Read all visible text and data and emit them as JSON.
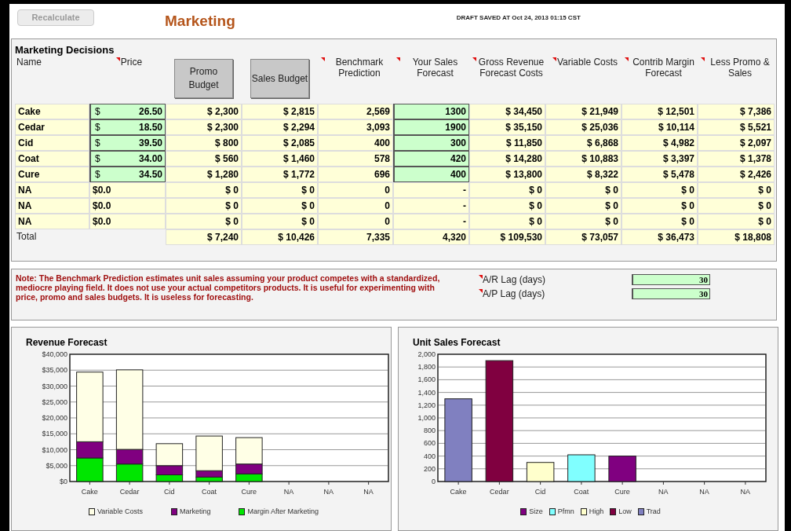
{
  "toolbar": {
    "recalculate_button": {
      "label": "Recalculate",
      "disabled": true
    },
    "title": "Marketing",
    "draft_status": "DRAFT SAVED AT Oct 24, 2013 01:15 CST"
  },
  "decisions": {
    "title": "Marketing Decisions",
    "columns": [
      {
        "label": "Name",
        "kind": "text",
        "comment": false
      },
      {
        "label": "Price",
        "kind": "text",
        "comment": true
      },
      {
        "label": "Promo Budget",
        "kind": "button",
        "comment": false
      },
      {
        "label": "Sales Budget",
        "kind": "button",
        "comment": false
      },
      {
        "label": "Benchmark Prediction",
        "kind": "text",
        "comment": true
      },
      {
        "label": "Your Sales Forecast",
        "kind": "text",
        "comment": true
      },
      {
        "label": "Gross Revenue Forecast Costs",
        "kind": "text",
        "comment": true
      },
      {
        "label": "Variable Costs",
        "kind": "text",
        "comment": true
      },
      {
        "label": "Contrib Margin Forecast",
        "kind": "text",
        "comment": true
      },
      {
        "label": "Less Promo & Sales",
        "kind": "text",
        "comment": true
      }
    ],
    "rows": [
      {
        "kind": "product",
        "name": "Cake",
        "currency": "$",
        "price": "26.50",
        "promo": "$ 2,300",
        "sales": "$ 2,815",
        "benchmark": "2,569",
        "forecast": "1300",
        "gross": "$ 34,450",
        "variable": "$ 21,949",
        "contrib": "$ 12,501",
        "less": "$ 7,386"
      },
      {
        "kind": "product",
        "name": "Cedar",
        "currency": "$",
        "price": "18.50",
        "promo": "$ 2,300",
        "sales": "$ 2,294",
        "benchmark": "3,093",
        "forecast": "1900",
        "gross": "$ 35,150",
        "variable": "$ 25,036",
        "contrib": "$ 10,114",
        "less": "$ 5,521"
      },
      {
        "kind": "product",
        "name": "Cid",
        "currency": "$",
        "price": "39.50",
        "promo": "$ 800",
        "sales": "$ 2,085",
        "benchmark": "400",
        "forecast": "300",
        "gross": "$ 11,850",
        "variable": "$ 6,868",
        "contrib": "$ 4,982",
        "less": "$ 2,097"
      },
      {
        "kind": "product",
        "name": "Coat",
        "currency": "$",
        "price": "34.00",
        "promo": "$ 560",
        "sales": "$ 1,460",
        "benchmark": "578",
        "forecast": "420",
        "gross": "$ 14,280",
        "variable": "$ 10,883",
        "contrib": "$ 3,397",
        "less": "$ 1,378"
      },
      {
        "kind": "product",
        "name": "Cure",
        "currency": "$",
        "price": "34.50",
        "promo": "$ 1,280",
        "sales": "$ 1,772",
        "benchmark": "696",
        "forecast": "400",
        "gross": "$ 13,800",
        "variable": "$ 8,322",
        "contrib": "$ 5,478",
        "less": "$ 2,426"
      },
      {
        "kind": "empty",
        "name": "NA",
        "price": "$0.0",
        "promo": "$ 0",
        "sales": "$ 0",
        "benchmark": "0",
        "forecast": "-",
        "gross": "$ 0",
        "variable": "$ 0",
        "contrib": "$ 0",
        "less": "$ 0"
      },
      {
        "kind": "empty",
        "name": "NA",
        "price": "$0.0",
        "promo": "$ 0",
        "sales": "$ 0",
        "benchmark": "0",
        "forecast": "-",
        "gross": "$ 0",
        "variable": "$ 0",
        "contrib": "$ 0",
        "less": "$ 0"
      },
      {
        "kind": "empty",
        "name": "NA",
        "price": "$0.0",
        "promo": "$ 0",
        "sales": "$ 0",
        "benchmark": "0",
        "forecast": "-",
        "gross": "$ 0",
        "variable": "$ 0",
        "contrib": "$ 0",
        "less": "$ 0"
      }
    ],
    "total": {
      "label": "Total",
      "promo": "$ 7,240",
      "sales": "$ 10,426",
      "benchmark": "7,335",
      "forecast": "4,320",
      "gross": "$ 109,530",
      "variable": "$ 73,057",
      "contrib": "$ 36,473",
      "less": "$ 18,808"
    }
  },
  "settings": {
    "note": "Note: The Benchmark Prediction estimates unit sales assuming your product competes with a standardized, mediocre playing field. It does not use your actual competitors products. It is useful for experimenting with price, promo and sales budgets. It is useless for forecasting.",
    "fields": [
      {
        "label": "A/R Lag (days)",
        "value": "30"
      },
      {
        "label": "A/P Lag (days)",
        "value": "30"
      }
    ]
  },
  "revenue_chart": {
    "chart_data": {
      "type": "bar",
      "title": "Revenue Forecast",
      "stacked": true,
      "categories": [
        "Cake",
        "Cedar",
        "Cid",
        "Coat",
        "Cure",
        "NA",
        "NA",
        "NA"
      ],
      "ylim": [
        0,
        40000
      ],
      "yticks": [
        {
          "value": 0,
          "label": "$0"
        },
        {
          "value": 5000,
          "label": "$5,000"
        },
        {
          "value": 10000,
          "label": "$10,000"
        },
        {
          "value": 15000,
          "label": "$15,000"
        },
        {
          "value": 20000,
          "label": "$20,000"
        },
        {
          "value": 25000,
          "label": "$25,000"
        },
        {
          "value": 30000,
          "label": "$30,000"
        },
        {
          "value": 35000,
          "label": "$35,000"
        },
        {
          "value": 40000,
          "label": "$40,000"
        }
      ],
      "series": [
        {
          "name": "Variable Costs",
          "color": "#ffffe6",
          "values": [
            21900,
            25000,
            6900,
            10900,
            8300,
            0,
            0,
            0
          ]
        },
        {
          "name": "Marketing",
          "color": "#800080",
          "values": [
            5100,
            4600,
            2900,
            2000,
            3100,
            0,
            0,
            0
          ]
        },
        {
          "name": "Margin After Marketing",
          "color": "#00e600",
          "values": [
            7400,
            5500,
            2100,
            1400,
            2400,
            0,
            0,
            0
          ]
        }
      ],
      "grid": true,
      "legend": true
    }
  },
  "unit_chart": {
    "chart_data": {
      "type": "bar",
      "title": "Unit Sales Forecast",
      "stacked": true,
      "categories": [
        "Cake",
        "Cedar",
        "Cid",
        "Coat",
        "Cure",
        "NA",
        "NA",
        "NA"
      ],
      "ylim": [
        0,
        2000
      ],
      "yticks": [
        {
          "value": 0,
          "label": "0"
        },
        {
          "value": 200,
          "label": "200"
        },
        {
          "value": 400,
          "label": "400"
        },
        {
          "value": 600,
          "label": "600"
        },
        {
          "value": 800,
          "label": "800"
        },
        {
          "value": 1000,
          "label": "1,000"
        },
        {
          "value": 1200,
          "label": "1,200"
        },
        {
          "value": 1400,
          "label": "1,400"
        },
        {
          "value": 1600,
          "label": "1,600"
        },
        {
          "value": 1800,
          "label": "1,800"
        },
        {
          "value": 2000,
          "label": "2,000"
        }
      ],
      "series": [
        {
          "name": "Size",
          "color": "#800080",
          "values": [
            null,
            null,
            null,
            null,
            400,
            null,
            null,
            null
          ]
        },
        {
          "name": "Pfmn",
          "color": "#80ffff",
          "values": [
            null,
            null,
            null,
            420,
            null,
            null,
            null,
            null
          ]
        },
        {
          "name": "High",
          "color": "#ffffcc",
          "values": [
            null,
            null,
            300,
            null,
            null,
            null,
            null,
            null
          ]
        },
        {
          "name": "Low",
          "color": "#800040",
          "values": [
            null,
            1900,
            null,
            null,
            null,
            null,
            null,
            null
          ]
        },
        {
          "name": "Trad",
          "color": "#8080c0",
          "values": [
            1300,
            null,
            null,
            null,
            null,
            null,
            null,
            null
          ]
        }
      ],
      "grid": true,
      "legend": true
    }
  }
}
